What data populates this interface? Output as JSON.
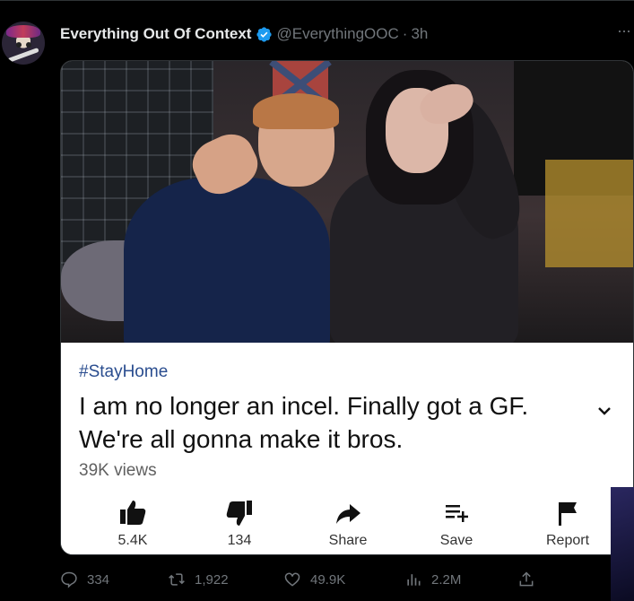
{
  "tweet": {
    "author_name": "Everything Out Of Context",
    "handle": "@EverythingOOC",
    "separator": "·",
    "time": "3h",
    "more_label": "···"
  },
  "media": {
    "hashtag": "#StayHome",
    "title_line1": "I am no longer an incel. Finally got a GF.",
    "title_line2": "We're all gonna make it bros.",
    "views": "39K views",
    "actions": [
      {
        "icon": "thumbs-up-icon",
        "label": "5.4K"
      },
      {
        "icon": "thumbs-down-icon",
        "label": "134"
      },
      {
        "icon": "share-icon",
        "label": "Share"
      },
      {
        "icon": "save-playlist-icon",
        "label": "Save"
      },
      {
        "icon": "flag-icon",
        "label": "Report"
      }
    ]
  },
  "stats": {
    "replies": "334",
    "retweets": "1,922",
    "likes": "49.9K",
    "views": "2.2M"
  },
  "colors": {
    "background": "#000000",
    "verified_blue": "#1d9bf0",
    "secondary_text": "#71767b",
    "hashtag": "#2a4d8f"
  }
}
